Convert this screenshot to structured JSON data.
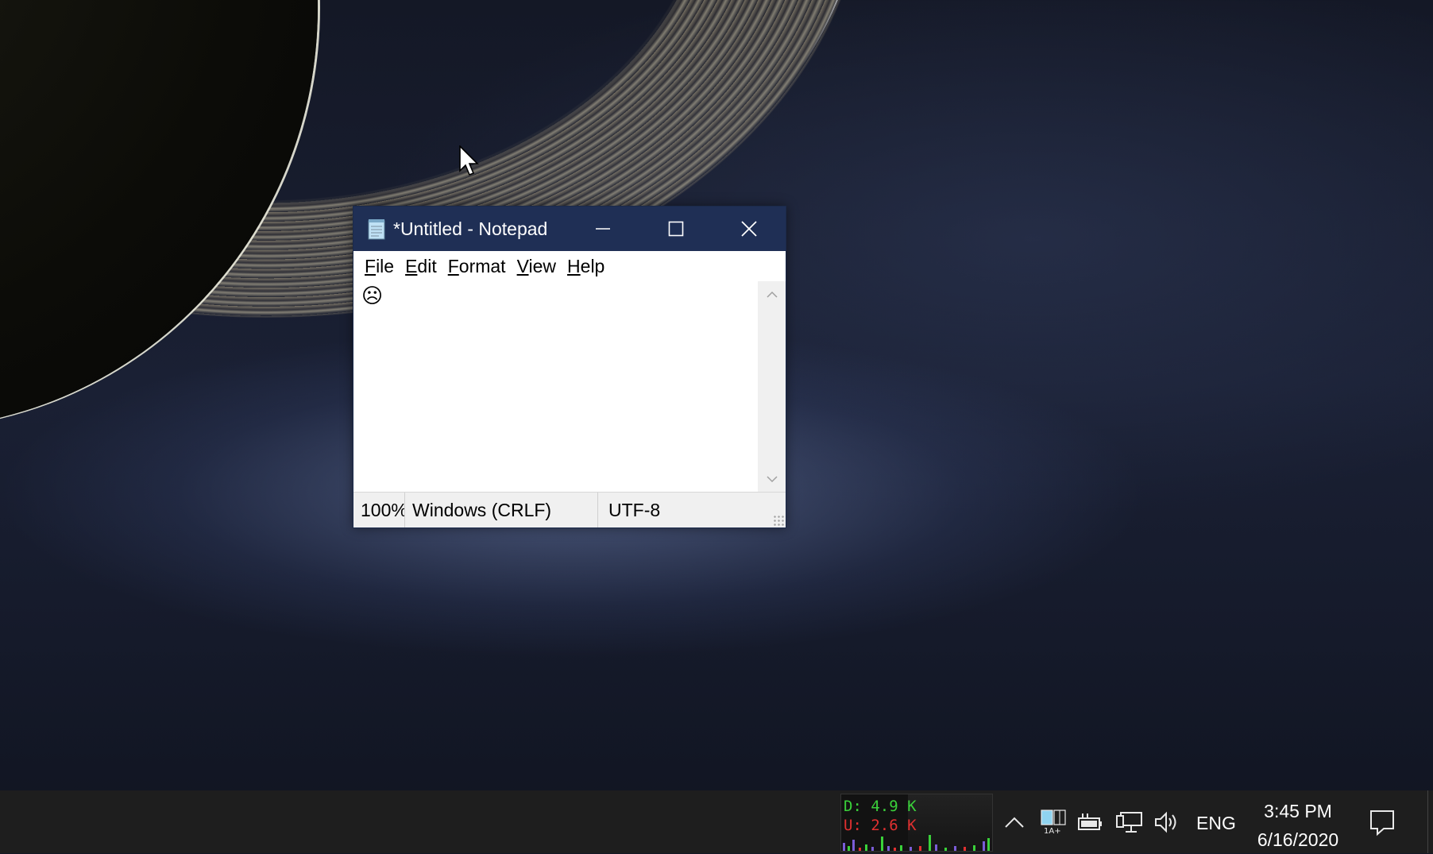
{
  "window": {
    "title": "*Untitled - Notepad",
    "menu": [
      {
        "key": "F",
        "rest": "ile"
      },
      {
        "key": "E",
        "rest": "dit"
      },
      {
        "key": "F",
        "rest": "ormat",
        "pre": "",
        "full": "Format"
      },
      {
        "key": "V",
        "rest": "iew"
      },
      {
        "key": "H",
        "rest": "elp"
      }
    ],
    "editor_text": "☹",
    "status": {
      "zoom": "100%",
      "line_ending": "Windows (CRLF)",
      "encoding": "UTF-8"
    }
  },
  "taskbar": {
    "net_download": "D: 4.9 K",
    "net_upload": "U: 2.6 K",
    "language": "ENG",
    "time": "3:45 PM",
    "date": "6/16/2020",
    "icons": [
      "chevron-up-icon",
      "input-method-icon",
      "battery-icon",
      "network-icon",
      "volume-icon",
      "notification-icon"
    ]
  },
  "colors": {
    "titlebar": "#1f2f55",
    "taskbar": "#1e1e1e",
    "net_down": "#3ad13a",
    "net_up": "#e03030"
  }
}
